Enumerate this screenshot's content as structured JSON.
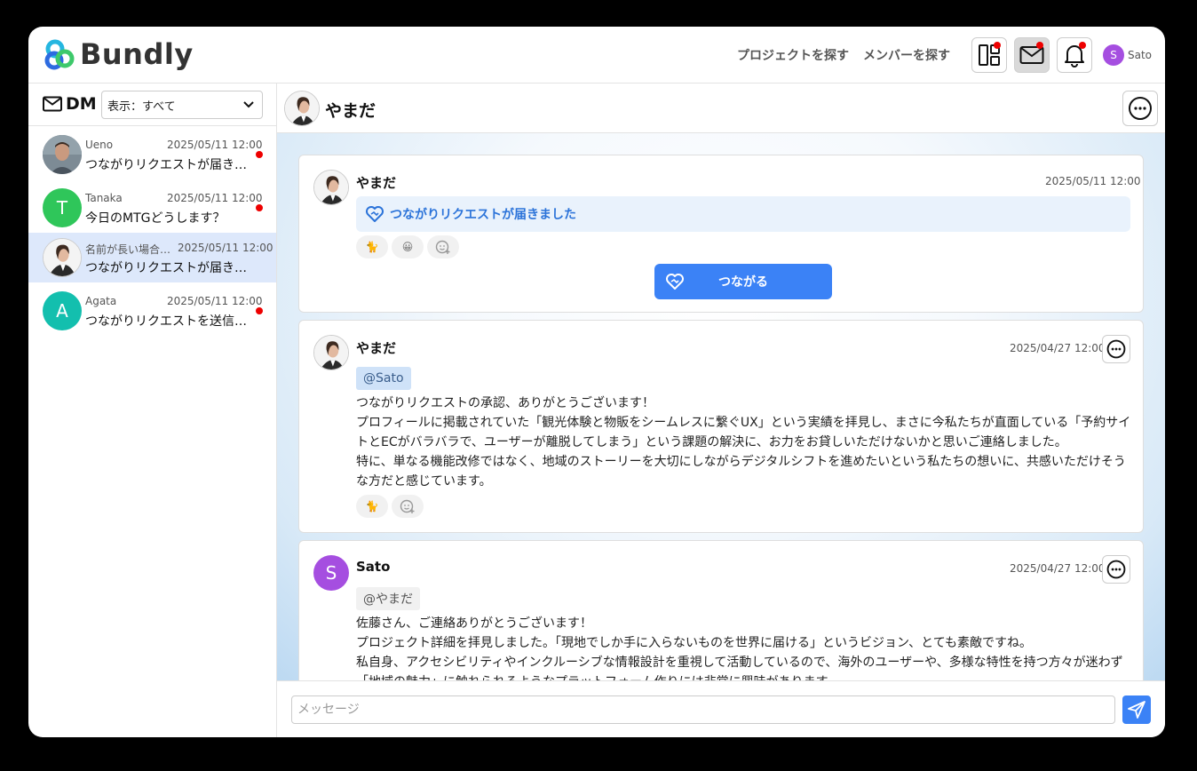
{
  "header": {
    "logo_text": "Bundly",
    "nav": [
      "プロジェクトを探す",
      "メンバーを探す"
    ],
    "icons": [
      "dashboard-icon",
      "mail-icon",
      "bell-icon"
    ],
    "user": {
      "initial": "S",
      "name": "Sato"
    }
  },
  "sidebar": {
    "title": "DM",
    "filter_value": "表示：すべて",
    "conversations": [
      {
        "name": "Ueno",
        "time": "2025/05/11 12:00",
        "preview": "つながりリクエストが届きました",
        "unread": true,
        "selected": false
      },
      {
        "name": "Tanaka",
        "initial": "T",
        "time": "2025/05/11 12:00",
        "preview": "今日のMTGどうします？",
        "unread": true,
        "selected": false
      },
      {
        "name": "名前が長い場合の表示",
        "time": "2025/05/11 12:00",
        "preview": "つながりリクエストが届きました",
        "unread": false,
        "selected": true
      },
      {
        "name": "Agata",
        "initial": "A",
        "time": "2025/05/11 12:00",
        "preview": "つながりリクエストを送信しました",
        "unread": true,
        "selected": false
      }
    ]
  },
  "thread": {
    "title": "やまだ",
    "messages": [
      {
        "sender": "やまだ",
        "time": "2025/05/11 12:00",
        "notice": "つながりリクエストが届きました",
        "reactions": [
          "🐈",
          "😀",
          "add-reaction-icon"
        ],
        "action_label": "つながる"
      },
      {
        "sender": "やまだ",
        "time": "2025/04/27 12:00",
        "mention": "@Sato",
        "lines": [
          "つながりリクエストの承認、ありがとうございます！",
          "プロフィールに掲載されていた「観光体験と物販をシームレスに繋ぐUX」という実績を拝見し、まさに今私たちが直面している「予約サイトとECがバラバラで、ユーザーが離脱してしまう」という課題の解決に、お力をお貸しいただけないかと思いご連絡しました。",
          "特に、単なる機能改修ではなく、地域のストーリーを大切にしながらデジタルシフトを進めたいという私たちの想いに、共感いただけそうな方だと感じています。"
        ],
        "reactions": [
          "🐈",
          "add-reaction-icon"
        ]
      },
      {
        "sender": "Sato",
        "initial": "S",
        "time": "2025/04/27 12:00",
        "mention": "@やまだ",
        "lines": [
          "佐藤さん、ご連絡ありがとうございます！",
          "プロジェクト詳細を拝見しました。「現地でしか手に入らないものを世界に届ける」というビジョン、とても素敵ですね。",
          "私自身、アクセシビリティやインクルーシブな情報設計を重視して活動しているので、海外のユーザーや、多様な特性を持つ方々が迷わず「地域の魅力」に触れられるようなプラットフォーム作りには非常に興味があります。"
        ]
      }
    ]
  },
  "composer": {
    "placeholder": "メッセージ"
  },
  "colors": {
    "accent": "#3b82f6",
    "unread": "#e00000",
    "selected_row": "#dde8fb",
    "sato_avatar": "#a54ee0",
    "tanaka_avatar": "#2fc65a",
    "agata_avatar": "#13bfae"
  }
}
